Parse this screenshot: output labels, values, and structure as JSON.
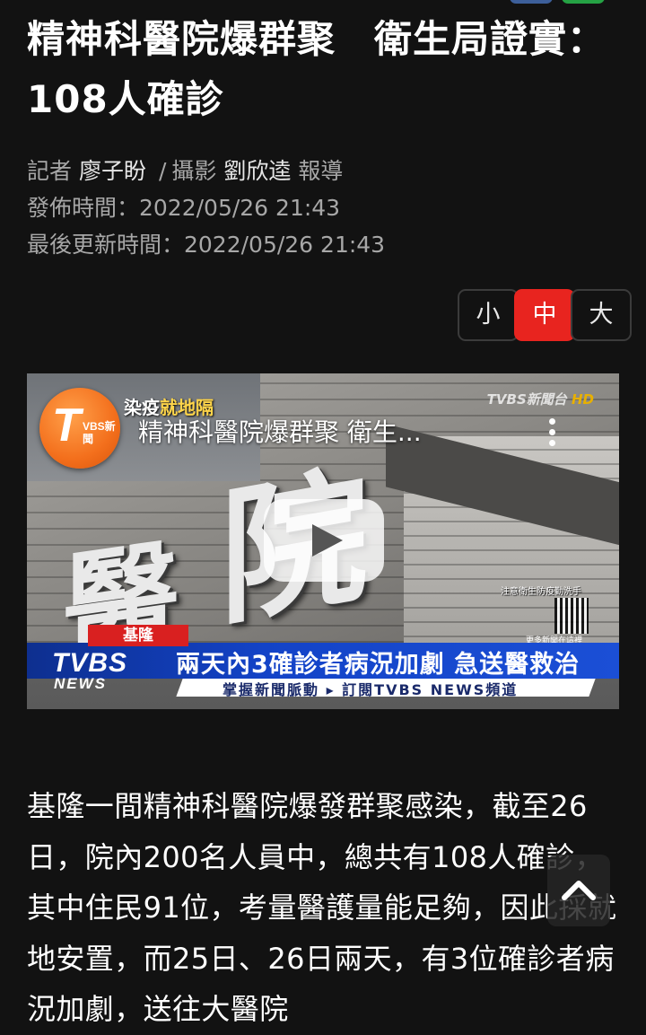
{
  "headline": "精神科醫院爆群聚　衛生局證實：108人確診",
  "byline": {
    "reporter_label": "記者",
    "reporter_name": "廖子盼",
    "separator": "/",
    "photographer_label": "攝影",
    "photographer_name": "劉欣逵",
    "suffix": "報導"
  },
  "published": "發佈時間：2022/05/26 21:43",
  "updated": "最後更新時間：2022/05/26 21:43",
  "font_size_options": [
    "小",
    "中",
    "大"
  ],
  "font_size_selected": "中",
  "video": {
    "title": "精神科醫院爆群聚 衛生...",
    "topic_tag_prefix": "染疫",
    "topic_tag_highlight": "就地隔",
    "watermark": "TVBS新聞台",
    "watermark_hd": "HD",
    "logo_letter": "T",
    "logo_sub": "VBS新聞",
    "location_tag": "基隆",
    "banner_headline": "兩天內3確診者病況加劇 急送醫救治",
    "sub_banner": "掌握新聞脈動 ▸ 訂閱TVBS NEWS頻道",
    "news_logo_line1": "TVBS",
    "news_logo_line2": "NEWS",
    "qr_note": "注意衛生防疫勤洗手",
    "qr_note2": "更多新聞在這裡"
  },
  "article_text": "基隆一間精神科醫院爆發群聚感染，截至26日，院內200名人員中，總共有108人確診，其中住民91位，考量醫護量能足夠，因此採就地安置，而25日、26日兩天，有3位確診者病況加劇，送往大醫院",
  "colors": {
    "background": "#121212",
    "accent_red": "#e8241f",
    "meta_gray": "#a7a7a7"
  },
  "icons": {
    "video_menu": "kebab-menu-icon",
    "play": "play-icon",
    "scroll_top": "chevron-up-icon"
  }
}
